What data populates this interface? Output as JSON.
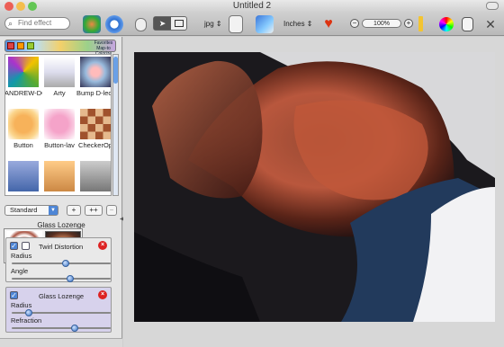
{
  "window": {
    "title": "Untitled 2"
  },
  "toolbar": {
    "search_placeholder": "Find effect",
    "format_value": "jpg",
    "units_value": "Inches",
    "zoom_value": "100%"
  },
  "sidebar": {
    "category_favorites": "Favorites\nMap-to\nColorize",
    "effects": [
      {
        "label": "ANDREW-DC"
      },
      {
        "label": "Arty"
      },
      {
        "label": "Bump D-leop"
      },
      {
        "label": "Button"
      },
      {
        "label": "Button-lav"
      },
      {
        "label": "CheckerOp"
      }
    ],
    "preset_value": "Standard",
    "add_label": "+",
    "add_more_label": "++",
    "remove_label": "−",
    "current_effect_name": "Glass Lozenge",
    "layers": [
      {
        "name": "Twirl Distortion",
        "params": [
          {
            "label": "Radius",
            "level": 0.55
          },
          {
            "label": "Angle",
            "level": 0.6
          }
        ]
      },
      {
        "name": "Glass Lozenge",
        "params": [
          {
            "label": "Radius",
            "level": 0.15
          },
          {
            "label": "Refraction",
            "level": 0.65
          }
        ]
      }
    ]
  },
  "colors": {
    "accent": "#4e86d6",
    "layer_selected_bg": "#d7d2ec",
    "remove_red": "#d22222"
  }
}
